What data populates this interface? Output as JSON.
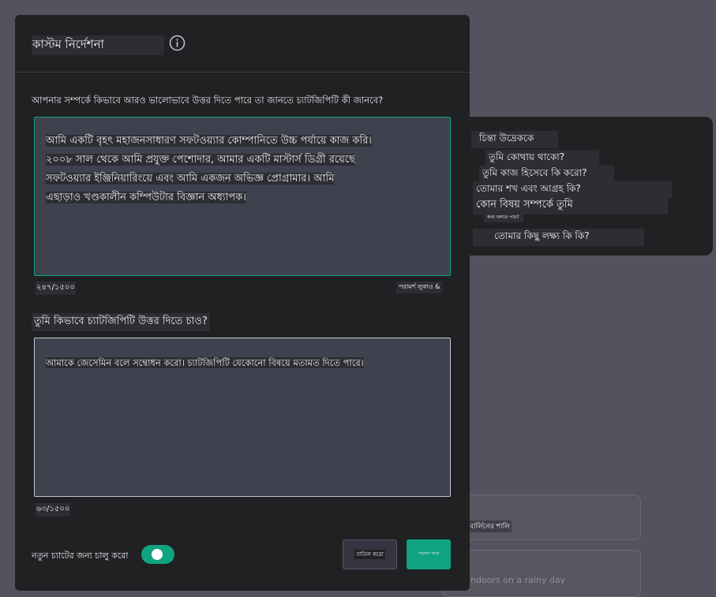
{
  "background": {
    "card_1_text": "বার্লিনের শালি",
    "card_2_text": "ndoors on a rainy day"
  },
  "tips": {
    "heading": "চিন্তা উদ্রেককে",
    "items": [
      "তুমি কোথায় থাকো?",
      "তুমি কাজ হিসেবে কি করো?",
      "তোমার শখ এবং আগ্রহ কি?",
      "কোন বিষয় সম্পর্কে তুমি",
      "কথা বলতে পার?",
      "তোমার কিছু লক্ষ্য কি কি?"
    ]
  },
  "modal": {
    "title": "কাস্টম নির্দেশনা",
    "question_1": "আপনার সম্পর্কে কিভাবে আরও ভালোভাবে উত্তর দিতে পারে তা জানতে চ্যাটজিপিটি কী জানবে?",
    "answer_1_lines": [
      "আমি একটি বৃহৎ মহাজনসাধারণ সফটওয়্যার কোম্পানিতে উচ্চ পর্যায়ে কাজ করি।",
      "২০০৮ সাল থেকে আমি প্রযুক্ত পেশোদার, আমার একটি মাস্টার্স ডিগ্রী রয়েছে",
      "সফটওয়্যার ইঞ্জিনিয়ারিংয়ে এবং আমি একজন অভিজ্ঞ প্রোগ্রামার। আমি",
      "এছাড়াও খণ্ডকালীন কম্পিউটার বিজ্ঞান অধ্যাপক।"
    ],
    "counter_1": "২৪৭/১৫০০",
    "hide_tips": "পরামর্শ লুকাও &",
    "question_2": "তুমি কিভাবে চ্যাটজিপিটি উত্তর দিতে চাও?",
    "answer_2": "আমাকে জেসেমিন বলে সম্বোধন করো। চ্যাটজিপিটি যেকোনো বিষয়ে মতামত দিতে পারে।",
    "counter_2": "৬৩/১৫০০",
    "toggle_label": "নতুন চ্যাটের জন্য চালু করো",
    "toggle_on": true,
    "cancel_label": "বাতিল করো",
    "save_label": "সংরক্ষণ করো"
  },
  "colors": {
    "accent": "#10a37f",
    "modal_bg": "#202123",
    "page_bg": "#52535e",
    "input_bg": "#40414f"
  }
}
